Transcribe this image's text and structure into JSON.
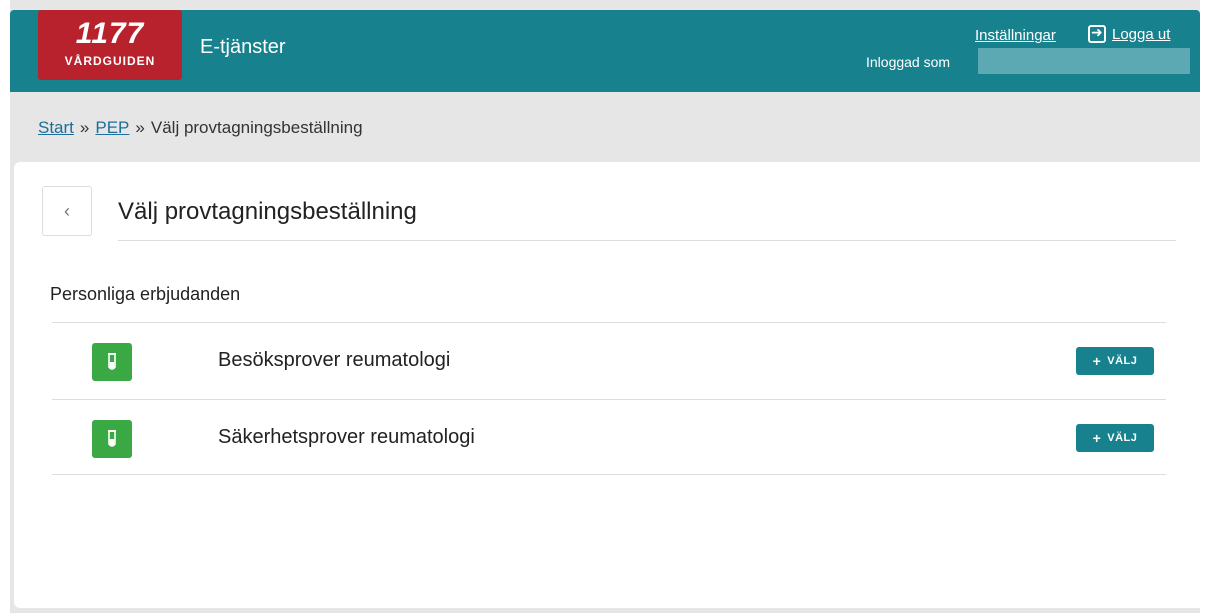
{
  "header": {
    "logo": {
      "number": "1177",
      "subtitle": "VÅRDGUIDEN"
    },
    "app_title": "E-tjänster",
    "settings_link": "Inställningar",
    "logout_label": "Logga ut",
    "logged_in_label": "Inloggad som"
  },
  "breadcrumb": {
    "items": [
      "Start",
      "PEP"
    ],
    "separator": "»",
    "current": "Välj provtagningsbeställning"
  },
  "page": {
    "back_label": "‹",
    "title": "Välj provtagningsbeställning",
    "section_heading": "Personliga erbjudanden",
    "offers": [
      {
        "label": "Besöksprover reumatologi",
        "icon": "test-tube-icon"
      },
      {
        "label": "Säkerhetsprover reumatologi",
        "icon": "test-tube-icon"
      }
    ],
    "choose_button": {
      "plus": "+",
      "label": "VÄLJ"
    }
  },
  "colors": {
    "header": "#17818e",
    "logo": "#b8222c",
    "icon_green": "#3aa843",
    "link": "#1b6f9a"
  }
}
